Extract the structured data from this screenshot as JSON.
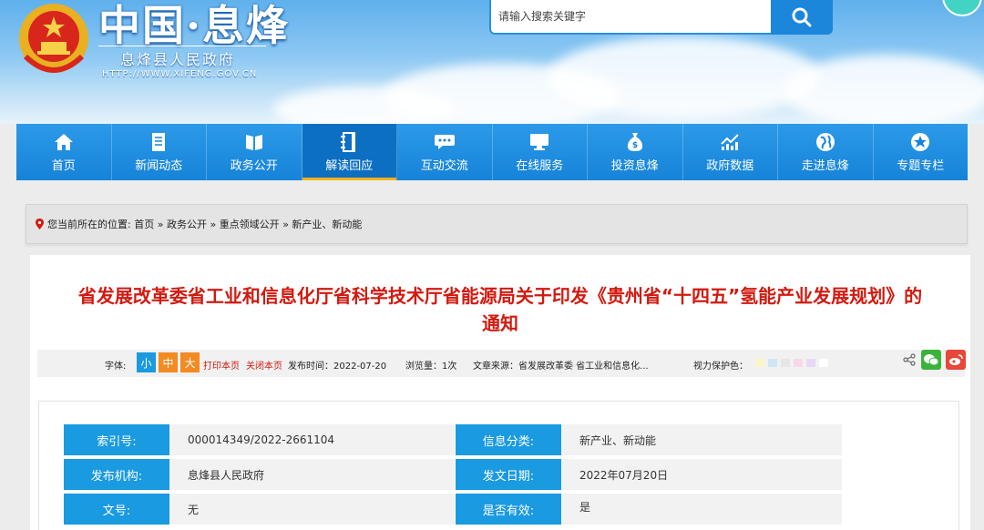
{
  "header": {
    "site_name": "中国·息烽",
    "gov_name": "息烽县人民政府",
    "url": "HTTP://WWW.XIFENG.GOV.CN",
    "search_placeholder": "请输入搜索关键字"
  },
  "nav": {
    "items": [
      {
        "label": "首页",
        "icon": "home-icon"
      },
      {
        "label": "新闻动态",
        "icon": "document-icon"
      },
      {
        "label": "政务公开",
        "icon": "book-icon"
      },
      {
        "label": "解读回应",
        "icon": "binder-icon"
      },
      {
        "label": "互动交流",
        "icon": "chat-icon"
      },
      {
        "label": "在线服务",
        "icon": "monitor-icon"
      },
      {
        "label": "投资息烽",
        "icon": "money-bag-icon"
      },
      {
        "label": "政府数据",
        "icon": "chart-icon"
      },
      {
        "label": "走进息烽",
        "icon": "globe-icon"
      },
      {
        "label": "专题专栏",
        "icon": "star-icon"
      }
    ],
    "active_index": 3
  },
  "breadcrumb": {
    "prefix": "您当前所在的位置:",
    "items": [
      "首页",
      "政务公开",
      "重点领域公开",
      "新产业、新动能"
    ],
    "separator": "»"
  },
  "article": {
    "title_line1": "省发展改革委省工业和信息化厅省科学技术厅省能源局关于印发《贵州省“十四五”氢能产业发展规划》的",
    "title_line2": "通知",
    "toolbar": {
      "font_label": "字体:",
      "font_small": "小",
      "font_medium": "中",
      "font_large": "大",
      "print": "打印本页",
      "close": "关闭本页",
      "publish_time": "发布时间：2022-07-20",
      "views": "浏览量：1次",
      "source": "文章来源：省发展改革委 省工业和信息化...",
      "eye_protect": "视力保护色：",
      "swatch_colors": [
        "#fbf6c8",
        "#cfe6f7",
        "#e6e6e6",
        "#f9d8e8",
        "#e6d9f7",
        "#ffffff"
      ]
    },
    "info": {
      "index_label": "索引号:",
      "index_value": "000014349/2022-2661104",
      "category_label": "信息分类:",
      "category_value": "新产业、新动能",
      "publisher_label": "发布机构:",
      "publisher_value": "息烽县人民政府",
      "date_label": "发文日期:",
      "date_value": "2022年07月20日",
      "docno_label": "文号:",
      "docno_value": "无",
      "valid_label": "是否有效:",
      "valid_value": "是"
    }
  },
  "colors": {
    "nav_blue": "#1683d8",
    "title_red": "#d11a10",
    "label_blue": "#1a9ae0",
    "font_btn_small": "#1a9ae0",
    "font_btn_medium": "#f28b22",
    "font_btn_large": "#f28b22"
  }
}
